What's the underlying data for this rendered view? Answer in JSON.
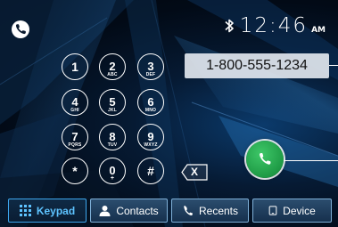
{
  "status": {
    "time": "12:46",
    "ampm": "AM",
    "icons": [
      "phone-icon",
      "bluetooth-icon"
    ]
  },
  "dial": {
    "number": "1-800-555-1234"
  },
  "keypad": [
    {
      "digit": "1",
      "letters": ""
    },
    {
      "digit": "2",
      "letters": "ABC"
    },
    {
      "digit": "3",
      "letters": "DEF"
    },
    {
      "digit": "4",
      "letters": "GHI"
    },
    {
      "digit": "5",
      "letters": "JKL"
    },
    {
      "digit": "6",
      "letters": "MNO"
    },
    {
      "digit": "7",
      "letters": "PQRS"
    },
    {
      "digit": "8",
      "letters": "TUV"
    },
    {
      "digit": "9",
      "letters": "WXYZ"
    },
    {
      "digit": "*",
      "letters": ""
    },
    {
      "digit": "0",
      "letters": "+"
    },
    {
      "digit": "#",
      "letters": ""
    }
  ],
  "backspace_label": "X",
  "tabs": {
    "keypad": "Keypad",
    "contacts": "Contacts",
    "recents": "Recents",
    "device": "Device"
  },
  "colors": {
    "accent": "#3da6ee",
    "call_green": "#1e9a45"
  }
}
